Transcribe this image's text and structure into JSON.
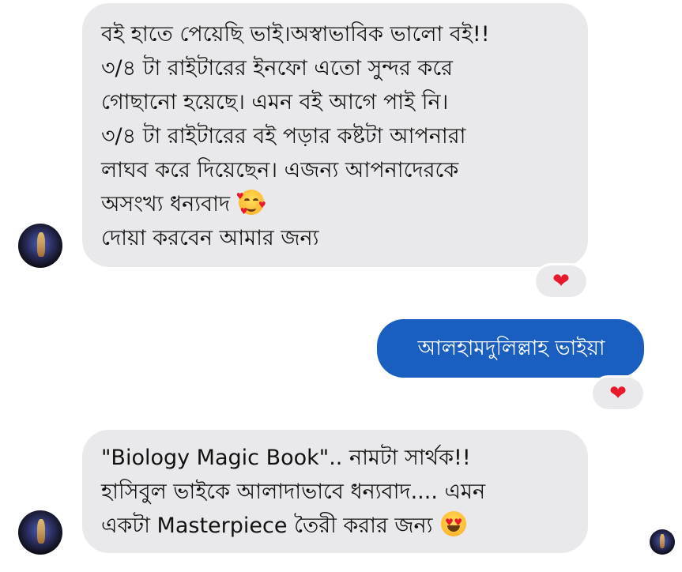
{
  "conversation": {
    "messages": [
      {
        "sender": "other",
        "text": "বই হাতে পেয়েছি ভাই।অস্বাভাবিক ভালো বই!!\n৩/৪ টা রাইটারের ইনফো এতো সুন্দর করে\nগোছানো হয়েছে। এমন বই আগে পাই নি।\n৩/৪ টা রাইটারের বই পড়ার কষ্টটা আপনারা\nলাঘব করে দিয়েছেন। এজন্য আপনাদেরকে\nঅসংখ্য ধন্যবাদ",
        "emoji": "smiling-face-with-hearts",
        "text_after_emoji": "\nদোয়া করবেন আমার জন্য",
        "reaction": "❤"
      },
      {
        "sender": "me",
        "text": "আলহামদুলিল্লাহ ভাইয়া",
        "reaction": "❤"
      },
      {
        "sender": "other",
        "text": "\"Biology Magic Book\".. নামটা সার্থক!!\nহাসিবুল ভাইকে আলাদাভাবে ধন্যবাদ.... এমন\nএকটা Masterpiece তৈরী করার জন্য",
        "emoji": "smiling-face-with-heart-eyes"
      }
    ]
  },
  "colors": {
    "incoming_bubble": "#e9e9eb",
    "outgoing_bubble": "#1a5fc0",
    "reaction_heart": "#e8192c"
  },
  "icons": {
    "sender_avatar": "profile-photo",
    "read_receipt": "profile-photo-small"
  }
}
